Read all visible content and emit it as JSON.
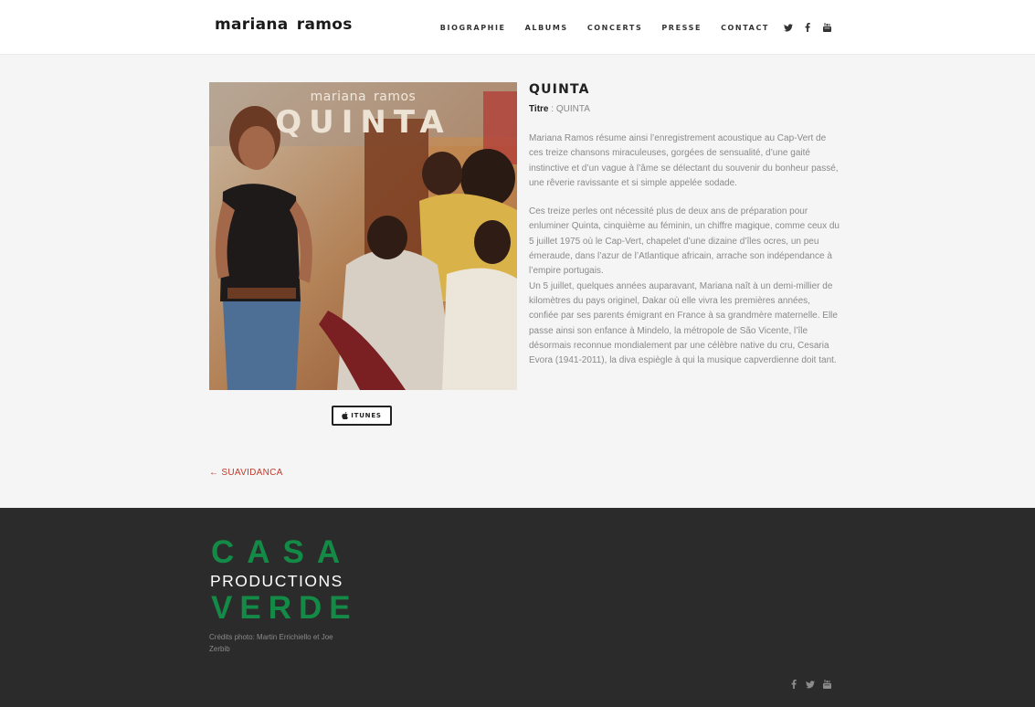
{
  "header": {
    "logo": "mariana ramos",
    "nav": [
      "BIOGRAPHIE",
      "ALBUMS",
      "CONCERTS",
      "PRESSE",
      "CONTACT"
    ],
    "social_icons": [
      "twitter-icon",
      "facebook-icon",
      "youtube-icon"
    ]
  },
  "album": {
    "cover_artist": "mariana ramos",
    "cover_title": "QUINTA",
    "title": "QUINTA",
    "meta_label": "Titre",
    "meta_sep": " : ",
    "meta_value": "QUINTA",
    "paragraphs": [
      "Mariana Ramos résume ainsi l’enregistrement acoustique au Cap-Vert de ces treize chansons miraculeuses, gorgées de sensualité, d’une gaité instinctive et d’un vague à l’âme se délectant du souvenir du bonheur passé, une rêverie ravissante et si simple appelée sodade.",
      "Ces treize perles ont nécessité plus de deux ans de préparation pour enluminer Quinta, cinquième au féminin, un chiffre magique, comme ceux du 5 juillet 1975 où le Cap-Vert, chapelet d’une dizaine d’îles ocres, un peu émeraude, dans l’azur de l’Atlantique africain, arrache son indépendance à l’empire portugais.",
      "Un 5 juillet, quelques années auparavant, Mariana naît à un demi-millier de kilomètres du pays originel, Dakar où elle vivra les premières années, confiée par ses parents émigrant en France à sa grandmère maternelle. Elle passe ainsi son enfance à Mindelo, la métropole de São Vicente, l’île désormais reconnue mondialement par une célèbre native du cru, Cesaria Evora (1941-2011), la diva espiègle à qui la musique capverdienne doit tant."
    ],
    "itunes_label": "ITUNES",
    "prev_link": "← SUAVIDANCA"
  },
  "footer": {
    "logo_top": "CASA",
    "logo_mid": "PRODUCTIONS",
    "logo_bottom": "VERDE",
    "credits": "Crédits photo: Martin Errichiello et Joe Zerbib",
    "social_icons": [
      "facebook-icon",
      "twitter-icon",
      "youtube-icon"
    ]
  },
  "colors": {
    "accent_link": "#c0392b",
    "footer_bg": "#2b2b2b",
    "brand_green": "#148a47"
  }
}
